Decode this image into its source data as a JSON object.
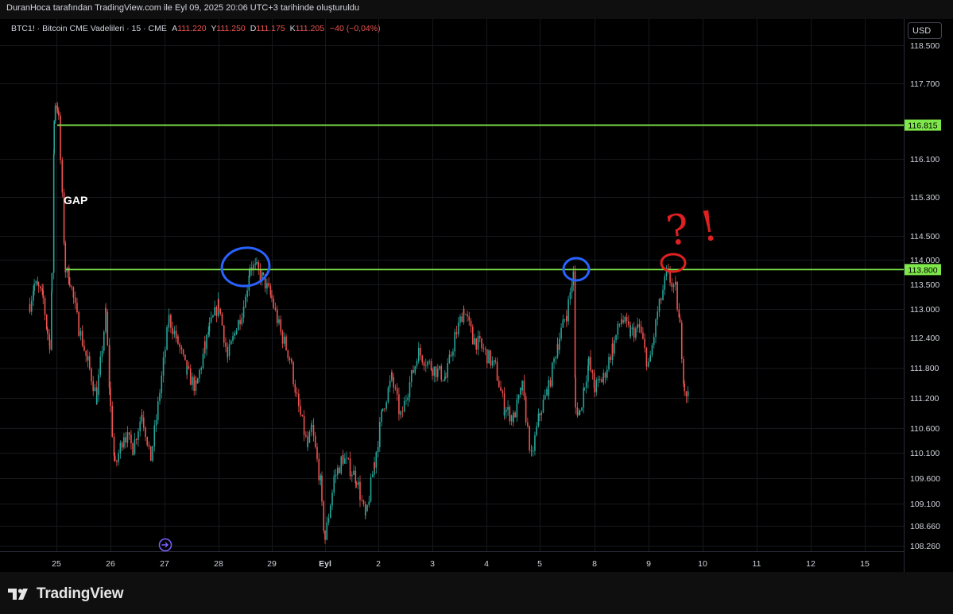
{
  "header": {
    "credit": "DuranHoca tarafından TradingView.com ile Eyl 09, 2025 20:06 UTC+3 tarihinde oluşturuldu"
  },
  "legend": {
    "symbol": "BTC1! · Bitcoin CME Vadelileri · 15 · CME",
    "open_label": "A",
    "open": "111.220",
    "high_label": "Y",
    "high": "111.250",
    "low_label": "D",
    "low": "111.175",
    "close_label": "K",
    "close": "111.205",
    "change": "−40 (−0,04%)"
  },
  "currency": "USD",
  "annotations": {
    "gap_label": "GAP",
    "question_mark": "?",
    "exclamation_mark": "!"
  },
  "colors": {
    "up": "#26a69a",
    "down": "#ef5350",
    "level_line": "#7ee84a",
    "circle_blue": "#2962ff",
    "circle_red": "#e02020",
    "axis_text": "#d1d4dc",
    "background": "#000000"
  },
  "branding": {
    "logo_text": "TradingView",
    "logo_icon": "tradingview-logo-icon"
  },
  "chart_data": {
    "type": "candlestick",
    "symbol": "BTC1!",
    "interval": "15",
    "currency": "USD",
    "y_ticks": [
      "118.500",
      "117.700",
      "116.100",
      "115.300",
      "114.500",
      "114.000",
      "113.500",
      "113.000",
      "112.400",
      "111.800",
      "111.200",
      "110.600",
      "110.100",
      "109.600",
      "109.100",
      "108.660",
      "108.260"
    ],
    "x_ticks": [
      "25",
      "26",
      "27",
      "28",
      "29",
      "Eyl",
      "2",
      "3",
      "4",
      "5",
      "8",
      "9",
      "10",
      "11",
      "12",
      "15"
    ],
    "ylim": [
      108.0,
      118.8
    ],
    "horizontal_levels": [
      {
        "label": "116.815",
        "value": 116.815
      },
      {
        "label": "113.800",
        "value": 113.8
      }
    ],
    "price_path": [
      [
        "Aug 24 12:00",
        113.1
      ],
      [
        "Aug 24 14:00",
        113.5
      ],
      [
        "Aug 24 16:00",
        113.4
      ],
      [
        "Aug 24 18:00",
        113.2
      ],
      [
        "Aug 24 20:00",
        112.5
      ],
      [
        "Aug 24 21:00",
        112.3
      ],
      [
        "Aug 24 22:00",
        113.6
      ],
      [
        "Aug 24 23:00",
        116.9
      ],
      [
        "Aug 24 23:30",
        117.3
      ],
      [
        "Aug 25 00:30",
        117.2
      ],
      [
        "Aug 25 01:00",
        116.9
      ],
      [
        "Aug 25 04:00",
        113.8
      ],
      [
        "Aug 25 06:00",
        113.6
      ],
      [
        "Aug 25 10:00",
        112.6
      ],
      [
        "Aug 25 14:00",
        111.9
      ],
      [
        "Aug 25 18:00",
        111.2
      ],
      [
        "Aug 25 22:00",
        112.9
      ],
      [
        "Aug 26 00:00",
        111.0
      ],
      [
        "Aug 26 02:00",
        109.8
      ],
      [
        "Aug 26 06:00",
        110.5
      ],
      [
        "Aug 26 10:00",
        110.2
      ],
      [
        "Aug 26 14:00",
        110.9
      ],
      [
        "Aug 26 18:00",
        110.0
      ],
      [
        "Aug 26 22:00",
        111.3
      ],
      [
        "Aug 27 02:00",
        112.8
      ],
      [
        "Aug 27 06:00",
        112.3
      ],
      [
        "Aug 27 10:00",
        111.7
      ],
      [
        "Aug 27 14:00",
        111.4
      ],
      [
        "Aug 27 18:00",
        112.2
      ],
      [
        "Aug 27 20:00",
        112.6
      ],
      [
        "Aug 28 00:00",
        113.1
      ],
      [
        "Aug 28 04:00",
        112.0
      ],
      [
        "Aug 28 08:00",
        112.6
      ],
      [
        "Aug 28 12:00",
        113.2
      ],
      [
        "Aug 28 14:00",
        113.9
      ],
      [
        "Aug 28 17:00",
        113.8
      ],
      [
        "Aug 28 20:00",
        113.6
      ],
      [
        "Aug 29 00:00",
        113.2
      ],
      [
        "Aug 29 04:00",
        112.5
      ],
      [
        "Aug 29 08:00",
        112.0
      ],
      [
        "Aug 29 12:00",
        111.0
      ],
      [
        "Aug 29 16:00",
        110.2
      ],
      [
        "Aug 29 18:00",
        110.6
      ],
      [
        "Aug 29 22:00",
        109.5
      ],
      [
        "Aug 31 20:00",
        109.0
      ],
      [
        "Sep 01 00:00",
        108.4
      ],
      [
        "Sep 01 04:00",
        109.6
      ],
      [
        "Sep 01 08:00",
        110.0
      ],
      [
        "Sep 01 14:00",
        109.6
      ],
      [
        "Sep 01 18:00",
        108.8
      ],
      [
        "Sep 01 22:00",
        109.9
      ],
      [
        "Sep 02 02:00",
        111.0
      ],
      [
        "Sep 02 06:00",
        111.6
      ],
      [
        "Sep 02 10:00",
        110.8
      ],
      [
        "Sep 02 14:00",
        111.5
      ],
      [
        "Sep 02 18:00",
        112.1
      ],
      [
        "Sep 03 00:00",
        111.8
      ],
      [
        "Sep 03 06:00",
        111.6
      ],
      [
        "Sep 03 10:00",
        112.4
      ],
      [
        "Sep 03 14:00",
        113.0
      ],
      [
        "Sep 03 18:00",
        112.4
      ],
      [
        "Sep 03 22:00",
        112.2
      ],
      [
        "Sep 04 04:00",
        111.8
      ],
      [
        "Sep 04 08:00",
        111.0
      ],
      [
        "Sep 04 12:00",
        110.8
      ],
      [
        "Sep 04 16:00",
        111.4
      ],
      [
        "Sep 04 20:00",
        110.0
      ],
      [
        "Sep 05 00:00",
        110.9
      ],
      [
        "Sep 05 04:00",
        111.4
      ],
      [
        "Sep 05 08:00",
        112.3
      ],
      [
        "Sep 05 12:00",
        112.9
      ],
      [
        "Sep 05 15:00",
        113.7
      ],
      [
        "Sep 05 16:00",
        111.0
      ],
      [
        "Sep 05 18:00",
        110.9
      ],
      [
        "Sep 05 20:00",
        111.5
      ],
      [
        "Sep 07 20:00",
        111.9
      ],
      [
        "Sep 08 00:00",
        111.4
      ],
      [
        "Sep 08 04:00",
        111.6
      ],
      [
        "Sep 08 08:00",
        112.2
      ],
      [
        "Sep 08 12:00",
        112.8
      ],
      [
        "Sep 08 16:00",
        112.5
      ],
      [
        "Sep 08 20:00",
        112.6
      ],
      [
        "Sep 09 00:00",
        111.8
      ],
      [
        "Sep 09 04:00",
        112.9
      ],
      [
        "Sep 09 08:00",
        113.7
      ],
      [
        "Sep 09 12:00",
        113.4
      ],
      [
        "Sep 09 14:00",
        112.6
      ],
      [
        "Sep 09 16:00",
        111.4
      ],
      [
        "Sep 09 18:00",
        111.2
      ]
    ]
  }
}
